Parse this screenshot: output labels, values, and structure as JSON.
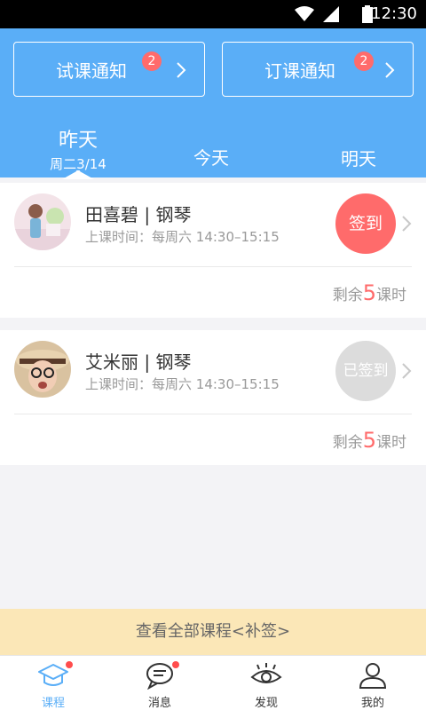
{
  "status_bar": {
    "time": "12:30"
  },
  "notices": [
    {
      "label": "试课通知",
      "badge": "2"
    },
    {
      "label": "订课通知",
      "badge": "2"
    }
  ],
  "day_tabs": {
    "yesterday": {
      "name": "昨天",
      "date": "周二3/14"
    },
    "today": {
      "name": "今天"
    },
    "tomorrow": {
      "name": "明天"
    }
  },
  "lessons": [
    {
      "teacher": "田喜碧 | 钢琴",
      "time_label": "上课时间：",
      "time_value": "每周六 14:30–15:15",
      "action": "签到",
      "remain_prefix": "剩余",
      "remain_num": "5",
      "remain_suffix": "课时"
    },
    {
      "teacher": "艾米丽 | 钢琴",
      "time_label": "上课时间：",
      "time_value": "每周六 14:30–15:15",
      "action": "已签到",
      "remain_prefix": "剩余",
      "remain_num": "5",
      "remain_suffix": "课时"
    }
  ],
  "footer_banner": "查看全部课程<补签>",
  "tabbar": [
    {
      "label": "课程",
      "icon": "graduation-cap-icon",
      "active": true,
      "dot": true
    },
    {
      "label": "消息",
      "icon": "message-icon",
      "active": false,
      "dot": true
    },
    {
      "label": "发现",
      "icon": "eye-icon",
      "active": false,
      "dot": false
    },
    {
      "label": "我的",
      "icon": "user-icon",
      "active": false,
      "dot": false
    }
  ],
  "colors": {
    "primary": "#5aaef7",
    "accent": "#ff6b6b",
    "banner": "#fbe7b7",
    "muted": "#999999"
  }
}
